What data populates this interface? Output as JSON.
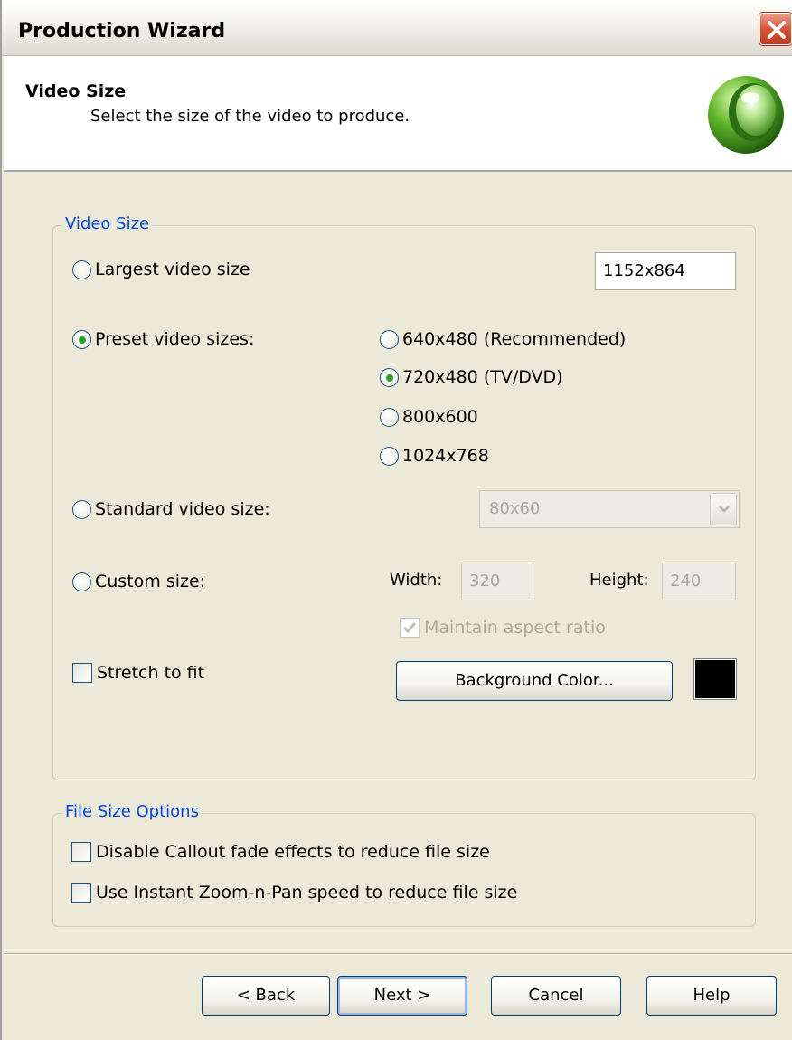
{
  "window": {
    "title": "Production Wizard"
  },
  "header": {
    "title": "Video Size",
    "subtitle": "Select the size of the video to produce."
  },
  "video_size_group": {
    "label": "Video Size",
    "largest": {
      "label": "Largest video size",
      "value": "1152x864",
      "selected": false
    },
    "preset": {
      "label": "Preset video sizes:",
      "selected": true,
      "options": [
        {
          "label": "640x480 (Recommended)",
          "selected": false
        },
        {
          "label": "720x480 (TV/DVD)",
          "selected": true
        },
        {
          "label": "800x600",
          "selected": false
        },
        {
          "label": "1024x768",
          "selected": false
        }
      ]
    },
    "standard": {
      "label": "Standard video size:",
      "value": "80x60",
      "selected": false
    },
    "custom": {
      "label": "Custom size:",
      "selected": false,
      "width_label": "Width:",
      "width_value": "320",
      "height_label": "Height:",
      "height_value": "240",
      "maintain_label": "Maintain aspect ratio",
      "maintain_checked": true
    },
    "stretch": {
      "label": "Stretch to fit",
      "checked": false
    },
    "background_button": "Background Color...",
    "background_color": "#000000"
  },
  "file_size_group": {
    "label": "File Size Options",
    "options": [
      {
        "label": "Disable Callout fade effects to reduce file size",
        "checked": false
      },
      {
        "label": "Use Instant Zoom-n-Pan speed to reduce file size",
        "checked": false
      }
    ]
  },
  "footer": {
    "back": "< Back",
    "next": "Next >",
    "cancel": "Cancel",
    "help": "Help"
  }
}
